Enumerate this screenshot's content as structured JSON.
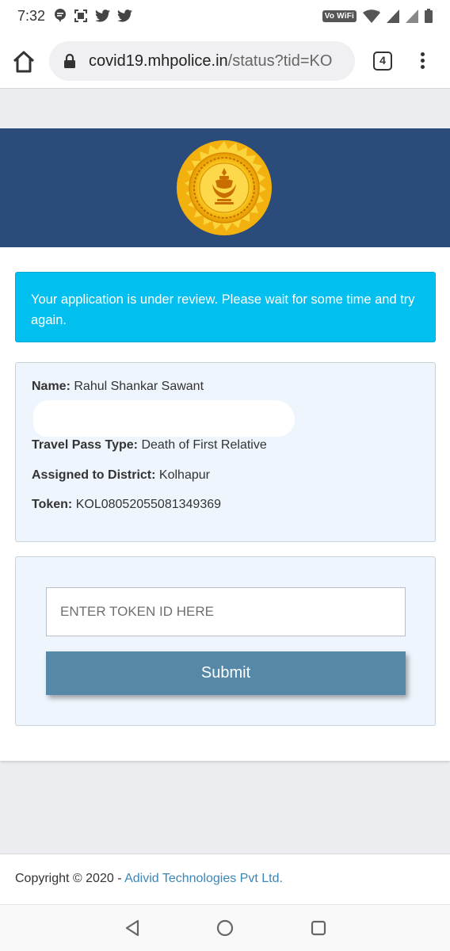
{
  "statusbar": {
    "time": "7:32",
    "left_icons": [
      "chat-bubble-icon",
      "screenshot-icon",
      "twitter-icon",
      "twitter-icon"
    ],
    "network_badge": "Vo WiFi",
    "right_icons": [
      "wifi-icon",
      "signal-icon",
      "signal-icon",
      "battery-icon"
    ]
  },
  "browser": {
    "url_domain": "covid19.mhpolice.in",
    "url_path": "/status?tid=KO",
    "tab_count": "4",
    "icons": {
      "home": "home-icon",
      "lock": "lock-icon",
      "menu": "more-vert-icon"
    }
  },
  "header": {
    "background_color": "#2b4b7a",
    "emblem": "maharashtra-seal-icon"
  },
  "alert": {
    "message": "Your application is under review. Please wait for some time and try again.",
    "color": "#01bfef"
  },
  "applicant": {
    "name_label": "Name:",
    "name_value": "Rahul Shankar Sawant",
    "pass_type_label": "Travel Pass Type:",
    "pass_type_value": "Death of First Relative",
    "district_label": "Assigned to District:",
    "district_value": "Kolhapur",
    "token_label": "Token:",
    "token_value": "KOL08052055081349369"
  },
  "form": {
    "token_placeholder": "ENTER TOKEN ID HERE",
    "submit_label": "Submit",
    "button_color": "#5689a7"
  },
  "footer": {
    "copyright": "Copyright © 2020 - ",
    "company": "Adivid Technologies Pvt Ltd."
  },
  "navbar": {
    "icons": [
      "back-triangle-icon",
      "home-circle-icon",
      "recents-square-icon"
    ]
  }
}
